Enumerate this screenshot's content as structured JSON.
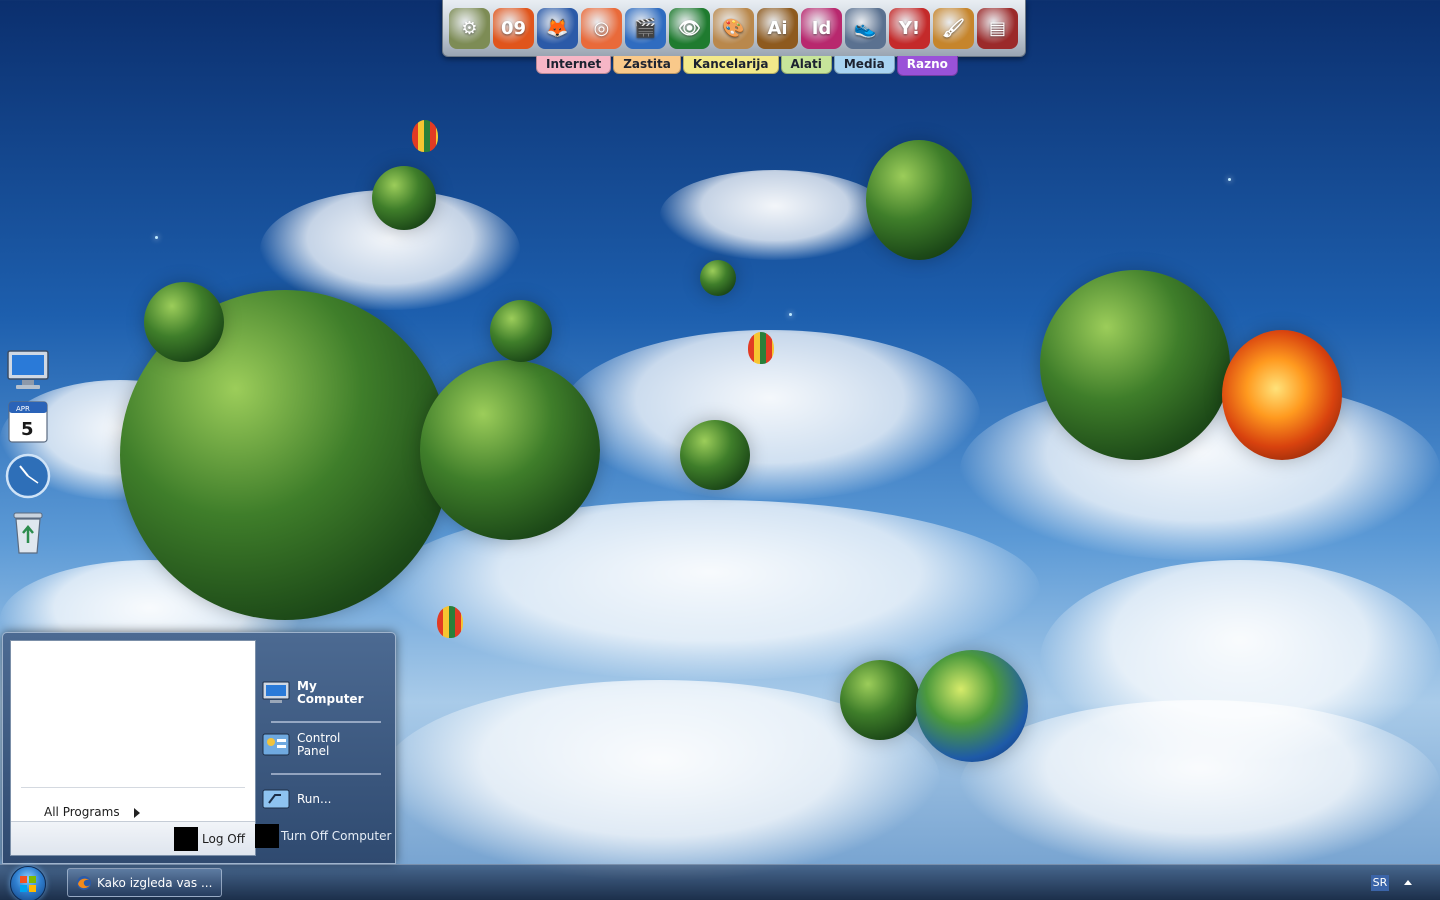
{
  "dock": {
    "icons": [
      {
        "name": "system-settings-icon",
        "glyph": "⚙",
        "color": "#7d8c55"
      },
      {
        "name": "nero-09-icon",
        "glyph": "09",
        "color": "#e0551c"
      },
      {
        "name": "firefox-icon",
        "glyph": "🦊",
        "color": "#2b5aa8"
      },
      {
        "name": "media-disc-icon",
        "glyph": "◎",
        "color": "#e96a3a"
      },
      {
        "name": "director-chair-icon",
        "glyph": "🎬",
        "color": "#2f6cc0"
      },
      {
        "name": "eye-icon",
        "glyph": "👁",
        "color": "#1f7b2f"
      },
      {
        "name": "paint-palette-icon",
        "glyph": "🎨",
        "color": "#b9884c"
      },
      {
        "name": "illustrator-icon",
        "glyph": "Ai",
        "color": "#8e5a1e"
      },
      {
        "name": "indesign-icon",
        "glyph": "Id",
        "color": "#b8286e"
      },
      {
        "name": "sneaker-icon",
        "glyph": "👟",
        "color": "#5a7190"
      },
      {
        "name": "yahoo-messenger-icon",
        "glyph": "Y!",
        "color": "#c42a2a"
      },
      {
        "name": "art-palette-icon",
        "glyph": "🖌",
        "color": "#c6852c"
      },
      {
        "name": "winrar-icon",
        "glyph": "▤",
        "color": "#9b2a2a"
      }
    ],
    "tabs": [
      {
        "label": "Internet",
        "color": "#f6b6c6",
        "active": false
      },
      {
        "label": "Zastita",
        "color": "#f9c98a",
        "active": false
      },
      {
        "label": "Kancelarija",
        "color": "#f2e98a",
        "active": false
      },
      {
        "label": "Alati",
        "color": "#c7e59a",
        "active": false
      },
      {
        "label": "Media",
        "color": "#a9d4f2",
        "active": false
      },
      {
        "label": "Razno",
        "color": "#9a52d8",
        "active": true
      }
    ]
  },
  "desktop_icons": [
    {
      "name": "my-computer-desktop-icon"
    },
    {
      "name": "calendar-desktop-icon",
      "month": "APR",
      "day": "5"
    },
    {
      "name": "clock-desktop-icon"
    },
    {
      "name": "recycle-bin-desktop-icon"
    }
  ],
  "start_menu": {
    "all_programs": "All Programs",
    "log_off": "Log Off",
    "turn_off": "Turn Off Computer",
    "right_items": {
      "my_computer": "My\nComputer",
      "control_panel": "Control\nPanel",
      "run": "Run..."
    }
  },
  "taskbar": {
    "task_button": "Kako izgleda vas ...",
    "language": "SR"
  }
}
